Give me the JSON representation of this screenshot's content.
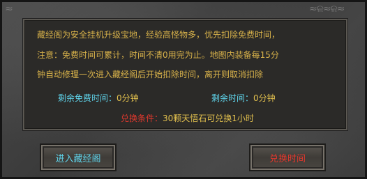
{
  "decor": {
    "dragon_right": "≈ଳ≈ଳ≈",
    "dragon_left": "≈"
  },
  "notice": {
    "line1": "藏经阁为安全挂机升级宝地，经验高怪物多，优先扣除免费时间，",
    "line2": "注意：免费时间可累计，时间不清0用完为止。地图内装备每15分",
    "line3": "钟自动修理一次进入藏经阁后开始扣除时间，离开则取消扣除"
  },
  "stats": {
    "free_time_label": "剩余免费时间：",
    "free_time_value": "0分钟",
    "remaining_time_label": "剩余时间：",
    "remaining_time_value": "0分钟"
  },
  "exchange": {
    "label": "兑换条件：",
    "value": "30颗天悟石可兑换1小时"
  },
  "buttons": {
    "enter_label": "进入藏经阁",
    "redeem_label": "兑换时间"
  },
  "colors": {
    "gold_text": "#d8b24a",
    "cyan_text": "#5fd3ea",
    "red_text": "#e0382d"
  }
}
